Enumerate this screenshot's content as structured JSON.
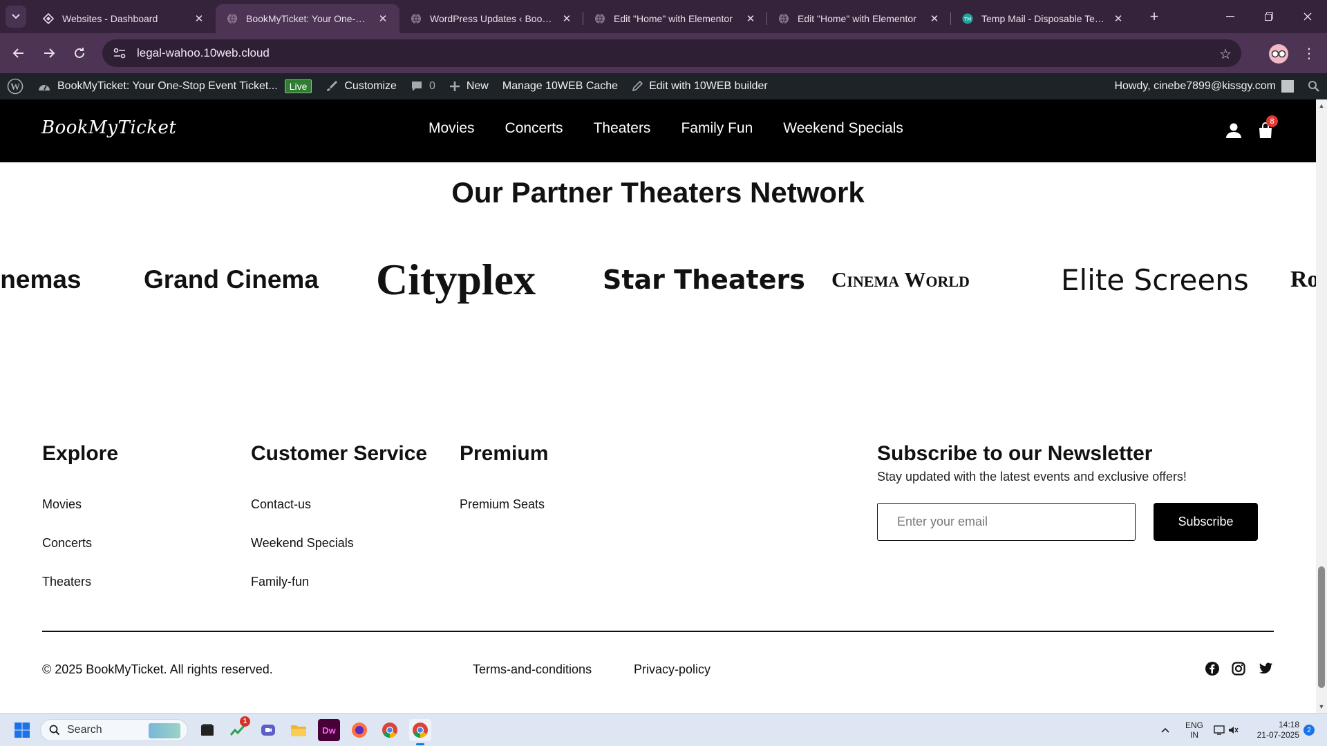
{
  "browser": {
    "tabs": [
      {
        "title": "Websites - Dashboard",
        "icon": "tenweb-icon",
        "active": false
      },
      {
        "title": "BookMyTicket: Your One-Stop",
        "icon": "globe-icon",
        "active": true
      },
      {
        "title": "WordPress Updates ‹ BookMyTi",
        "icon": "globe-icon",
        "active": false
      },
      {
        "title": "Edit \"Home\" with Elementor",
        "icon": "globe-icon",
        "active": false
      },
      {
        "title": "Edit \"Home\" with Elementor",
        "icon": "globe-icon",
        "active": false
      },
      {
        "title": "Temp Mail - Disposable Tempo",
        "icon": "tempmail-icon",
        "active": false
      }
    ],
    "url": "legal-wahoo.10web.cloud"
  },
  "adminbar": {
    "site_name": "BookMyTicket: Your One-Stop Event Ticket...",
    "live_label": "Live",
    "customize": "Customize",
    "comments_count": "0",
    "new_label": "New",
    "cache_label": "Manage 10WEB Cache",
    "builder_label": "Edit with 10WEB builder",
    "howdy": "Howdy, cinebe7899@kissgy.com"
  },
  "header": {
    "logo": "BookMyTicket",
    "nav": [
      "Movies",
      "Concerts",
      "Theaters",
      "Family Fun",
      "Weekend Specials"
    ],
    "cart_count": "8"
  },
  "partners": {
    "title": "Our Partner Theaters Network",
    "logos": [
      "inemas",
      "Grand Cinema",
      "Cityplex",
      "Star Theaters",
      "Cinema World",
      "Elite Screens",
      "Ro"
    ]
  },
  "footer": {
    "columns": [
      {
        "title": "Explore",
        "links": [
          "Movies",
          "Concerts",
          "Theaters"
        ]
      },
      {
        "title": "Customer Service",
        "links": [
          "Contact-us",
          "Weekend Specials",
          "Family-fun"
        ]
      },
      {
        "title": "Premium",
        "links": [
          "Premium Seats"
        ]
      }
    ],
    "newsletter": {
      "title": "Subscribe to our Newsletter",
      "subtitle": "Stay updated with the latest events and exclusive offers!",
      "placeholder": "Enter your email",
      "button": "Subscribe"
    },
    "copyright": "© 2025 BookMyTicket. All rights reserved.",
    "legal_links": [
      "Terms-and-conditions",
      "Privacy-policy"
    ],
    "social": [
      "facebook-icon",
      "instagram-icon",
      "twitter-icon"
    ]
  },
  "taskbar": {
    "search_label": "Search",
    "notification_badge": "1",
    "language": "ENG",
    "region": "IN",
    "time": "14:18",
    "date": "21-07-2025",
    "notification_count": "2"
  },
  "colors": {
    "tabstrip": "#35233b",
    "toolbar": "#4d3354",
    "adminbar": "#1d2327",
    "header": "#000000",
    "live_badge": "#2e7d32"
  }
}
